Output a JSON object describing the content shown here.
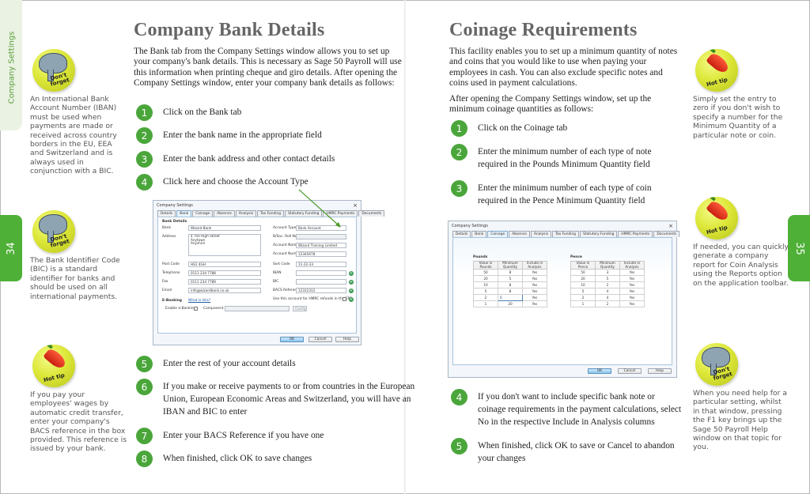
{
  "left_page": {
    "section_tab": "Company Settings",
    "page_number": "34",
    "title": "Company Bank Details",
    "intro": "The Bank tab from the Company Settings window allows you to set up your company's bank details. This is necessary as Sage 50 Payroll will use this information when printing cheque and giro details. After opening the Company Settings window, enter your company bank details as follows:",
    "steps_before": [
      {
        "num": "1",
        "text": "Click on the Bank tab"
      },
      {
        "num": "2",
        "text": "Enter the bank name in the appropriate field"
      },
      {
        "num": "3",
        "text": "Enter the bank address and other contact details"
      },
      {
        "num": "4",
        "text": "Click here and choose the Account Type"
      }
    ],
    "steps_after": [
      {
        "num": "5",
        "text": "Enter the rest of your account details"
      },
      {
        "num": "6",
        "text": "If you make or receive payments to or from countries in the European Union, European Economic Areas and Switzerland, you will have an IBAN and BIC to enter"
      },
      {
        "num": "7",
        "text": "Enter your BACS Reference if you have one"
      },
      {
        "num": "8",
        "text": "When finished, click OK to save changes"
      }
    ],
    "notes": [
      {
        "badge": "Don't forget",
        "icon": "elephant-icon",
        "text": "An International Bank Account Number (IBAN) must be used when payments are made or received across country borders in the EU, EEA and Switzerland and is always used in conjunction with a BIC."
      },
      {
        "badge": "Don't forget",
        "icon": "elephant-icon",
        "text": "The Bank Identifier Code (BIC) is a standard identifier for banks and should be used on all international payments."
      },
      {
        "badge": "Hot tip",
        "icon": "chili-pepper-icon",
        "text": "If you pay your employees' wages by automatic credit transfer, enter your company's BACS reference in the box provided. This reference is issued by your bank."
      }
    ],
    "dialog": {
      "title": "Company Settings",
      "tabs": [
        "Details",
        "Bank",
        "Coinage",
        "Absence",
        "Analysis",
        "Tax Funding",
        "Statutory Funding",
        "HMRC Payments",
        "Documents"
      ],
      "active_tab": "Bank",
      "section_label": "Bank Details",
      "fields": {
        "bank_label": "Bank",
        "bank": "Wizard Bank",
        "address_label": "Address",
        "address": "4 The High Street\nAnytown\nAnyshire",
        "postcode_label": "Post Code",
        "postcode": "HS1 4GH",
        "telephone_label": "Telephone",
        "telephone": "0111 234 7788",
        "fax_label": "Fax",
        "fax": "0111 234 7789",
        "email_label": "Email",
        "email": "info@wizardbank.co.uk",
        "account_type_label": "Account Type",
        "account_type": "Bank Account",
        "bsoc_label": "B/Soc. Roll No",
        "bsoc": "",
        "account_name_label": "Account Name",
        "account_name": "Wizard Training Limited",
        "account_number_label": "Account Number",
        "account_number": "12345678",
        "sort_code_label": "Sort Code",
        "sort_code": "11-22-33",
        "iban_label": "IBAN",
        "iban": "",
        "bic_label": "BIC",
        "bic": "",
        "bacs_label": "BACS Reference",
        "bacs": "12312312",
        "hmrc_refund_label": "Use this account for HMRC refunds in the EPS"
      },
      "ebanking_label": "E-Banking",
      "what_is_this": "What is this?",
      "enable_ebanking_label": "Enable e-Banking",
      "component_label": "Component",
      "config_button": "Config...",
      "ok": "OK",
      "cancel": "Cancel",
      "help": "Help"
    }
  },
  "right_page": {
    "page_number": "35",
    "title": "Coinage Requirements",
    "intro": "This facility enables you to set up a minimum quantity of notes and coins that you would like to use when paying your employees in cash. You can also exclude specific notes and coins used in payment calculations.",
    "intro2": "After opening the Company Settings window, set up the minimum coinage quantities as follows:",
    "steps_before": [
      {
        "num": "1",
        "text": "Click on the Coinage tab"
      },
      {
        "num": "2",
        "text": "Enter the minimum number of each type of note required in the Pounds Minimum Quantity field"
      },
      {
        "num": "3",
        "text": "Enter the minimum number of each type of coin required in the Pence Minimum Quantity field"
      }
    ],
    "steps_after": [
      {
        "num": "4",
        "text": "If you don't want to include specific bank note or coinage requirements in the payment calculations, select No in the respective Include in Analysis columns"
      },
      {
        "num": "5",
        "text": "When finished, click OK to save or Cancel to abandon your changes"
      }
    ],
    "notes": [
      {
        "badge": "Hot tip",
        "icon": "chili-pepper-icon",
        "text": "Simply set the entry to zero if you don't wish to specify a number for the Minimum Quantity of a particular note or coin."
      },
      {
        "badge": "Hot tip",
        "icon": "chili-pepper-icon",
        "text": "If needed, you can quickly generate a company report for Coin Analysis using the Reports option on the application toolbar."
      },
      {
        "badge": "Don't forget",
        "icon": "elephant-icon",
        "text": "When you need help for a particular setting, whilst in that window, pressing the F1 key brings up the Sage 50 Payroll Help window on that topic for you."
      }
    ],
    "dialog": {
      "title": "Company Settings",
      "tabs": [
        "Details",
        "Bank",
        "Coinage",
        "Absence",
        "Analysis",
        "Tax Funding",
        "Statutory Funding",
        "HMRC Payments",
        "Documents"
      ],
      "active_tab": "Coinage",
      "pounds": {
        "title": "Pounds",
        "headers": [
          "Value in Pounds",
          "Minimum Quantity",
          "Include in Analysis"
        ],
        "rows": [
          [
            "50",
            "8",
            "Yes"
          ],
          [
            "20",
            "5",
            "Yes"
          ],
          [
            "10",
            "8",
            "Yes"
          ],
          [
            "5",
            "8",
            "Yes"
          ],
          [
            "2",
            "0",
            "Yes"
          ],
          [
            "1",
            "20",
            "Yes"
          ]
        ]
      },
      "pence": {
        "title": "Pence",
        "headers": [
          "Value in Pence",
          "Minimum Quantity",
          "Include in Analysis"
        ],
        "rows": [
          [
            "50",
            "3",
            "Yes"
          ],
          [
            "20",
            "5",
            "Yes"
          ],
          [
            "10",
            "2",
            "Yes"
          ],
          [
            "5",
            "4",
            "Yes"
          ],
          [
            "2",
            "4",
            "Yes"
          ],
          [
            "1",
            "2",
            "Yes"
          ]
        ]
      },
      "ok": "OK",
      "cancel": "Cancel",
      "help": "Help"
    }
  }
}
